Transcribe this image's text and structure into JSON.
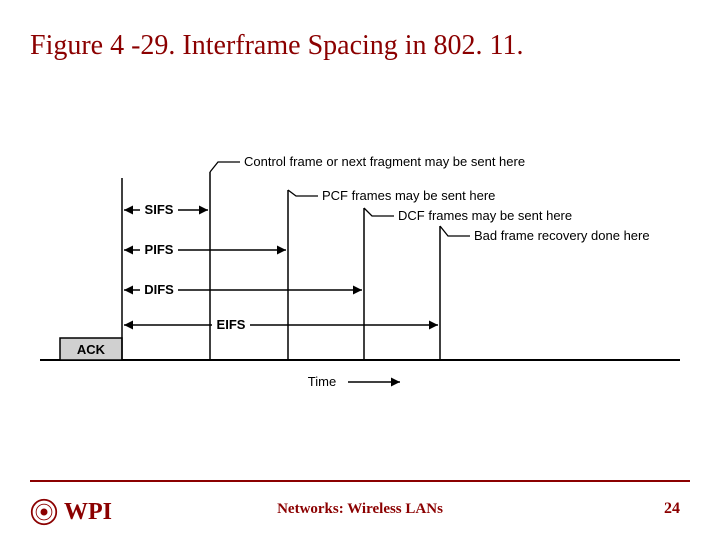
{
  "title": "Figure 4 -29. Interframe Spacing in 802. 11.",
  "diagram": {
    "ack_label": "ACK",
    "intervals": {
      "sifs": "SIFS",
      "pifs": "PIFS",
      "difs": "DIFS",
      "eifs": "EIFS"
    },
    "annotations": {
      "sifs_note": "Control frame or next fragment may be sent here",
      "pifs_note": "PCF frames may be sent here",
      "difs_note": "DCF frames may be sent here",
      "eifs_note": "Bad frame recovery done here"
    },
    "axis_label": "Time"
  },
  "footer": {
    "course": "Networks: Wireless LANs",
    "page_number": "24",
    "institution": "WPI"
  }
}
